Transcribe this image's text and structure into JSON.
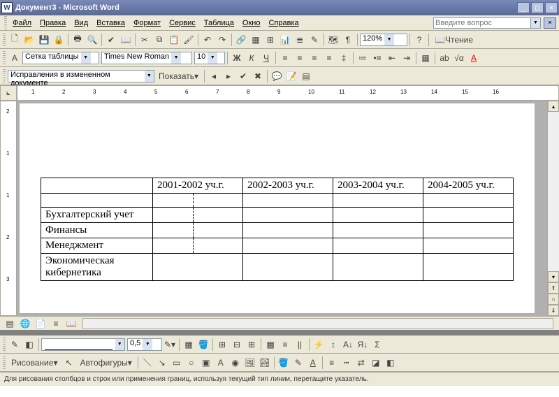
{
  "window": {
    "title": "Документ3 - Microsoft Word",
    "min": "_",
    "max": "□",
    "close": "×"
  },
  "menu": {
    "file": "Файл",
    "edit": "Правка",
    "view": "Вид",
    "insert": "Вставка",
    "format": "Формат",
    "tools": "Сервис",
    "table": "Таблица",
    "window": "Окно",
    "help": "Справка"
  },
  "help_box": {
    "placeholder": "Введите вопрос"
  },
  "toolbar1": {
    "zoom": "120%",
    "reading": "Чтение"
  },
  "toolbar2": {
    "style": "Сетка таблицы",
    "font": "Times New Roman",
    "size": "10"
  },
  "toolbar3": {
    "track": "Исправления в измененном документе",
    "show": "Показать"
  },
  "ruler_h": [
    "1",
    "2",
    "3",
    "4",
    "5",
    "6",
    "7",
    "8",
    "9",
    "10",
    "11",
    "12",
    "13",
    "14",
    "15",
    "16"
  ],
  "ruler_v": [
    "2",
    "1",
    "1",
    "2",
    "3"
  ],
  "table": {
    "headers": [
      "",
      "2001-2002 уч.г.",
      "2002-2003 уч.г.",
      "2003-2004 уч.г.",
      "2004-2005 уч.г."
    ],
    "rows": [
      [
        "",
        "",
        "",
        "",
        ""
      ],
      [
        "Бухгалтерский учет",
        "",
        "",
        "",
        ""
      ],
      [
        "Финансы",
        "",
        "",
        "",
        ""
      ],
      [
        "Менеджмент",
        "",
        "",
        "",
        ""
      ],
      [
        "Экономическая кибернетика",
        "",
        "",
        "",
        ""
      ]
    ]
  },
  "border_toolbar": {
    "weight": "0,5"
  },
  "drawing_toolbar": {
    "draw": "Рисование",
    "autoshapes": "Автофигуры"
  },
  "status": {
    "text": "Для рисования столбцов и строк или применения границ, используя текущий тип линии, перетащите указатель."
  }
}
